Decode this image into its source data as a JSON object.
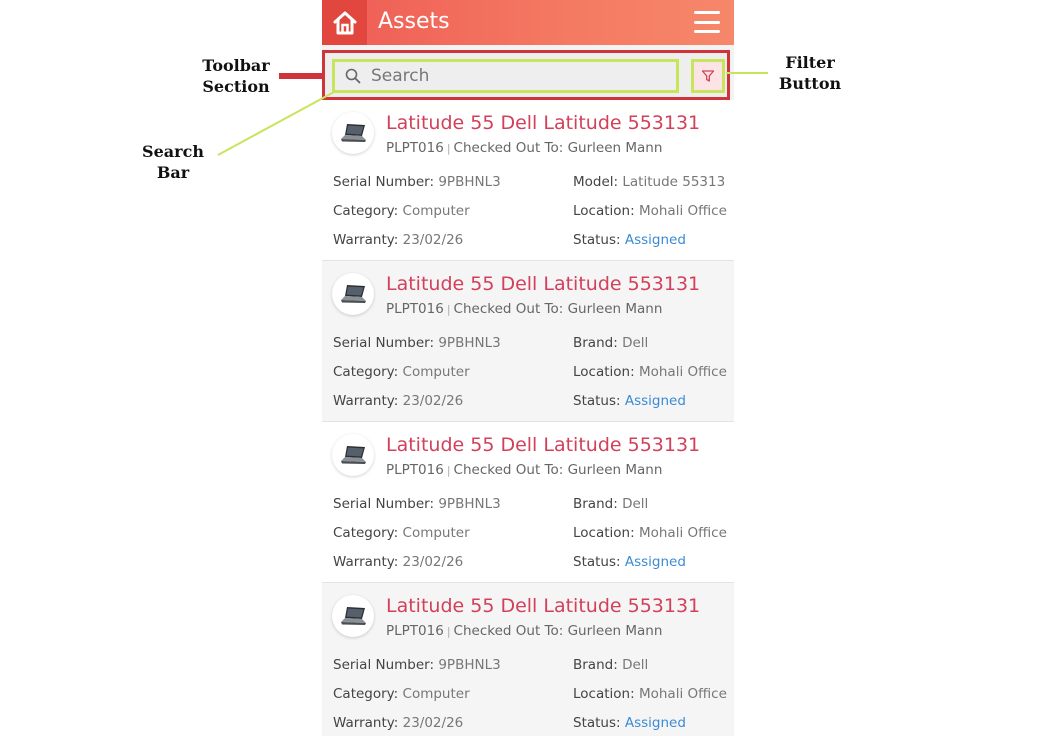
{
  "header": {
    "title": "Assets",
    "home_icon": "home-icon",
    "menu_icon": "hamburger-menu-icon",
    "accent_color": "#ef5c55"
  },
  "toolbar": {
    "search_placeholder": "Search",
    "filter_icon": "filter-icon"
  },
  "labels": {
    "serial": "Serial Number:",
    "model": "Model:",
    "brand": "Brand:",
    "category": "Category:",
    "location": "Location:",
    "warranty": "Warranty:",
    "status": "Status:"
  },
  "assets": [
    {
      "title": "Latitude 55 Dell Latitude 553131",
      "asset_id": "PLPT016",
      "checked_out": "Checked Out To: Gurleen Mann",
      "serial": "9PBHNL3",
      "right_top_label": "Model:",
      "right_top_value": "Latitude 55313",
      "category": "Computer",
      "location": "Mohali Office",
      "warranty": "23/02/26",
      "status": "Assigned"
    },
    {
      "title": "Latitude 55 Dell Latitude 553131",
      "asset_id": "PLPT016",
      "checked_out": "Checked Out To: Gurleen Mann",
      "serial": "9PBHNL3",
      "right_top_label": "Brand:",
      "right_top_value": "Dell",
      "category": "Computer",
      "location": "Mohali Office",
      "warranty": "23/02/26",
      "status": "Assigned"
    },
    {
      "title": "Latitude 55 Dell Latitude 553131",
      "asset_id": "PLPT016",
      "checked_out": "Checked Out To: Gurleen Mann",
      "serial": "9PBHNL3",
      "right_top_label": "Brand:",
      "right_top_value": "Dell",
      "category": "Computer",
      "location": "Mohali Office",
      "warranty": "23/02/26",
      "status": "Assigned"
    },
    {
      "title": "Latitude 55 Dell Latitude 553131",
      "asset_id": "PLPT016",
      "checked_out": "Checked Out To: Gurleen Mann",
      "serial": "9PBHNL3",
      "right_top_label": "Brand:",
      "right_top_value": "Dell",
      "category": "Computer",
      "location": "Mohali Office",
      "warranty": "23/02/26",
      "status": "Assigned"
    }
  ],
  "annotations": {
    "toolbar_line1": "Toolbar",
    "toolbar_line2": "Section",
    "search_line1": "Search",
    "search_line2": "Bar",
    "filter_line1": "Filter",
    "filter_line2": "Button",
    "toolbar_color": "#d0343b",
    "highlight_color": "#c7e55a"
  }
}
